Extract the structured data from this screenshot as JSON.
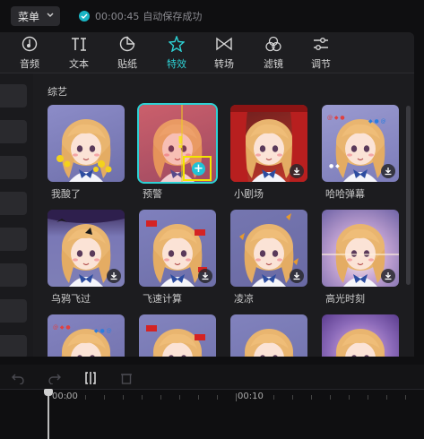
{
  "topbar": {
    "menu_label": "菜单",
    "save_time": "00:00:45",
    "save_text": "自动保存成功"
  },
  "tabs": [
    {
      "label": "音频",
      "icon": "audio-icon"
    },
    {
      "label": "文本",
      "icon": "text-icon"
    },
    {
      "label": "贴纸",
      "icon": "sticker-icon"
    },
    {
      "label": "特效",
      "icon": "effects-icon",
      "active": true
    },
    {
      "label": "转场",
      "icon": "transition-icon"
    },
    {
      "label": "滤镜",
      "icon": "filter-icon"
    },
    {
      "label": "调节",
      "icon": "adjust-icon"
    }
  ],
  "section": {
    "title": "综艺"
  },
  "effects": [
    {
      "name": "我酸了"
    },
    {
      "name": "预警",
      "selected": true,
      "add_label": "+"
    },
    {
      "name": "小剧场",
      "download": true
    },
    {
      "name": "哈哈弹幕",
      "download": true
    },
    {
      "name": "乌鸦飞过",
      "download": true
    },
    {
      "name": "飞速计算",
      "download": true
    },
    {
      "name": "凌凉",
      "download": true
    },
    {
      "name": "高光时刻",
      "download": true
    },
    {
      "name": ""
    },
    {
      "name": ""
    },
    {
      "name": ""
    },
    {
      "name": ""
    }
  ],
  "timeline": {
    "t0": "00:00",
    "t1": "00:10"
  },
  "colors": {
    "accent": "#2ed1d4",
    "highlight": "#f2e600"
  }
}
